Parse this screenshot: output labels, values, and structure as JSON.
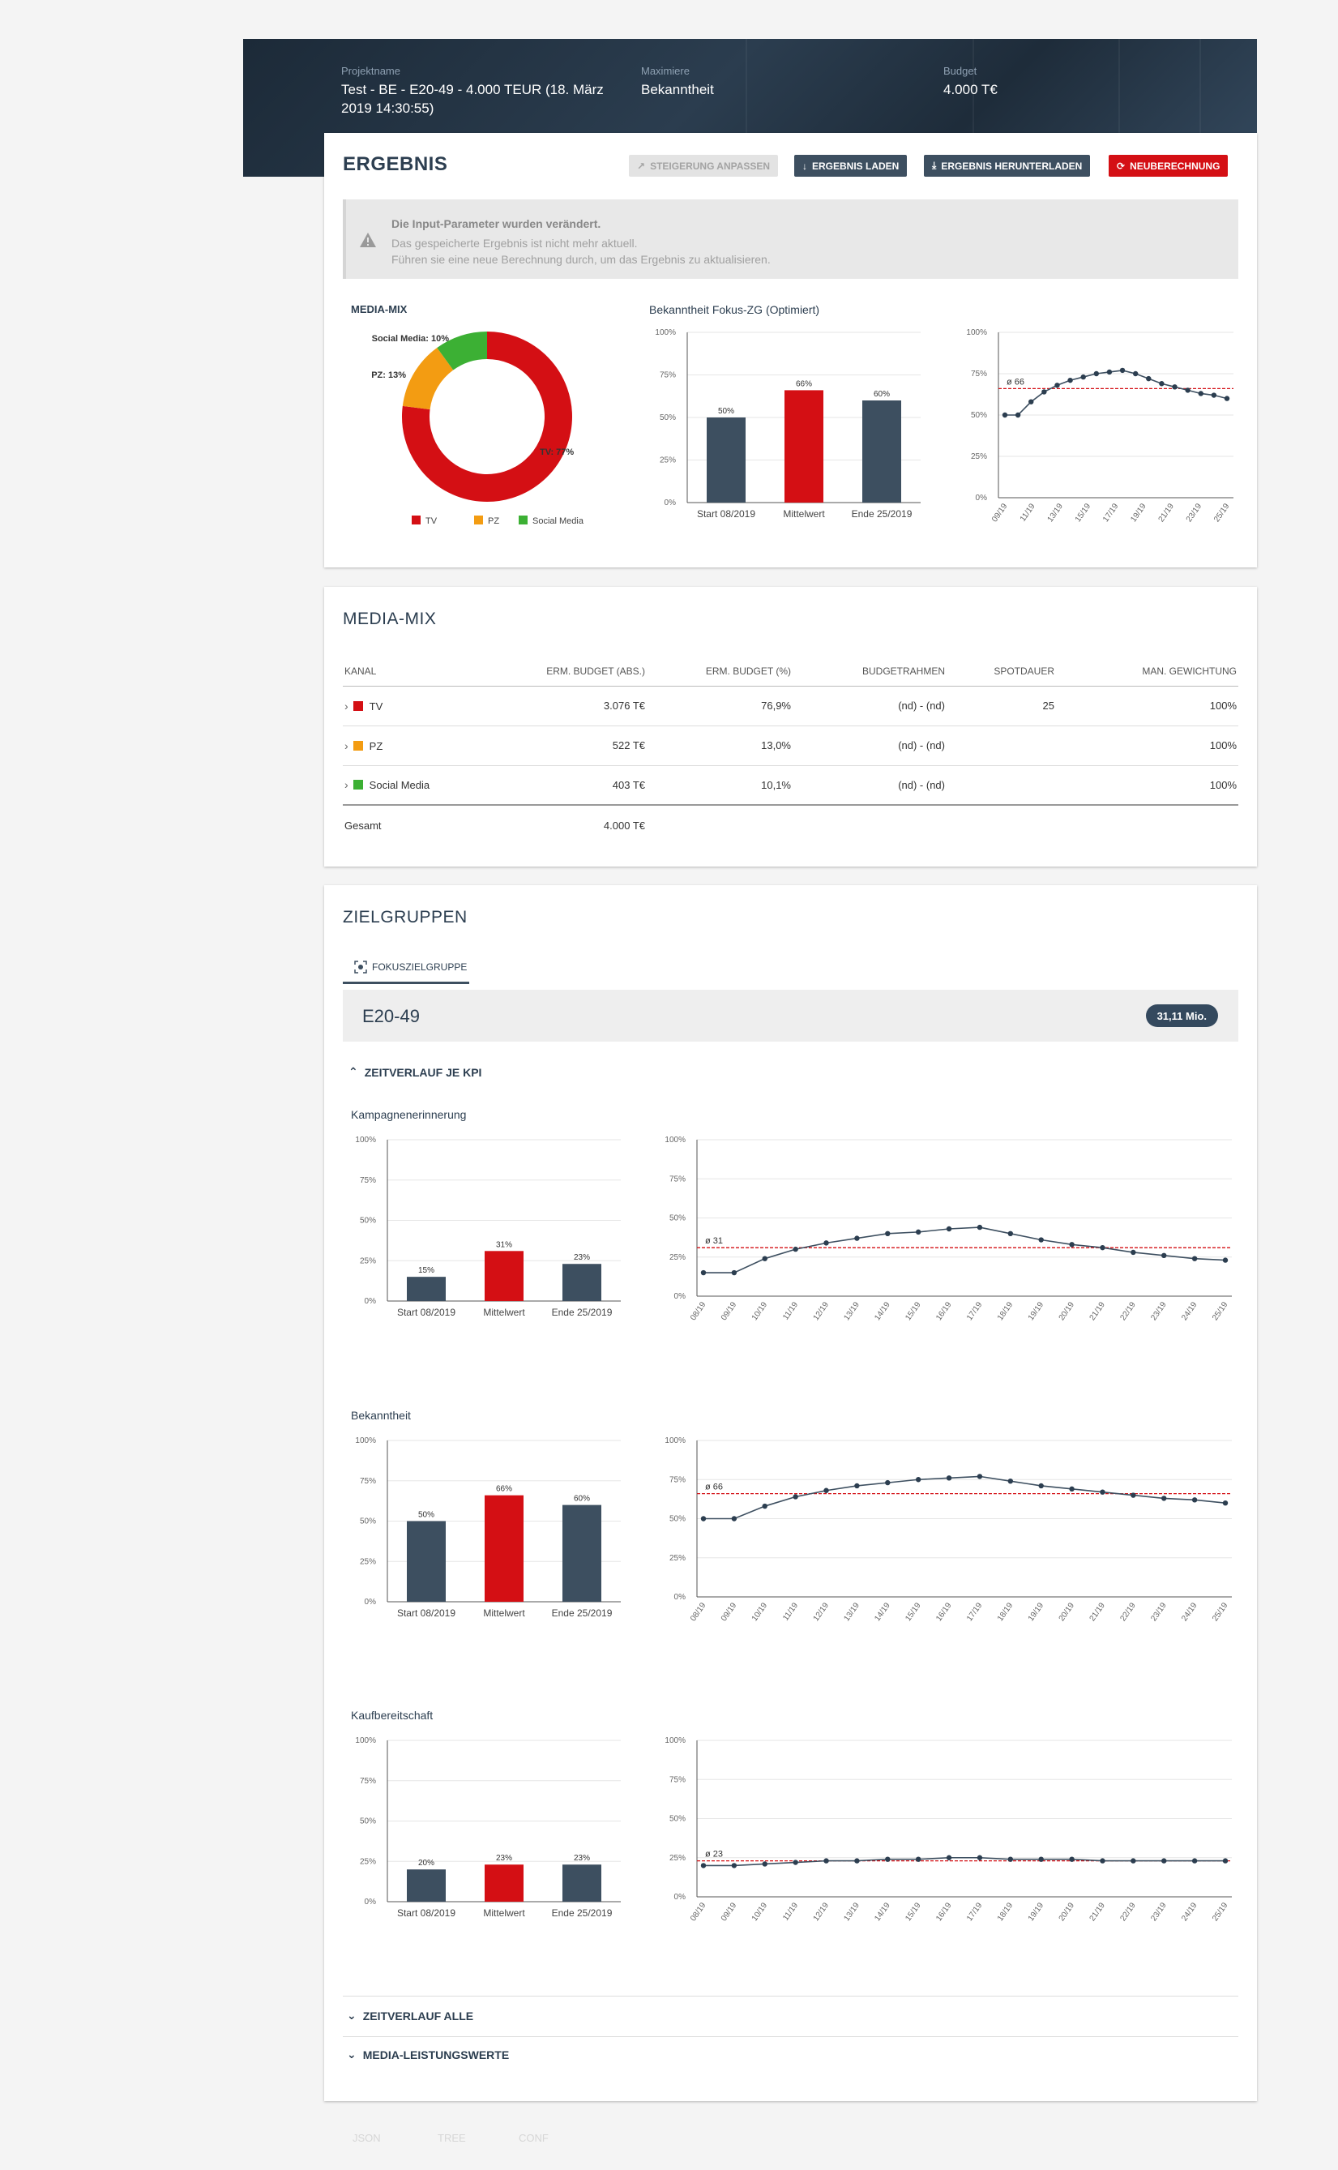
{
  "header": {
    "project_label": "Projektname",
    "project_value": "Test - BE - E20-49 - 4.000 TEUR (18. März 2019 14:30:55)",
    "maximize_label": "Maximiere",
    "maximize_value": "Bekanntheit",
    "budget_label": "Budget",
    "budget_value": "4.000 T€"
  },
  "ergebnis": {
    "title": "ERGEBNIS",
    "buttons": {
      "steigerung": "STEIGERUNG ANPASSEN",
      "laden": "ERGEBNIS LADEN",
      "herunterladen": "ERGEBNIS HERUNTERLADEN",
      "neuberechnung": "NEUBERECHNUNG"
    },
    "warning": {
      "title": "Die Input-Parameter wurden verändert.",
      "line1": "Das gespeicherte Ergebnis ist nicht mehr aktuell.",
      "line2": "Führen sie eine neue Berechnung durch, um das Ergebnis zu aktualisieren."
    },
    "media_mix_label": "MEDIA-MIX",
    "bekanntheit_label": "Bekanntheit Fokus-ZG (Optimiert)",
    "legend": [
      "TV",
      "PZ",
      "Social Media"
    ]
  },
  "colors": {
    "tv": "#d40f14",
    "pz": "#f39c12",
    "social": "#3cb034",
    "bar": "#3d4f60",
    "accent": "#d40f14"
  },
  "chart_data": [
    {
      "type": "pie",
      "title": "MEDIA-MIX",
      "categories": [
        "TV",
        "PZ",
        "Social Media"
      ],
      "values": [
        77,
        13,
        10
      ],
      "labels": [
        "TV: 77%",
        "PZ: 13%",
        "Social Media: 10%"
      ],
      "legend": "bottom"
    },
    {
      "type": "bar",
      "title": "Bekanntheit Fokus-ZG (Optimiert)",
      "categories": [
        "Start 08/2019",
        "Mittelwert",
        "Ende 25/2019"
      ],
      "values": [
        50,
        66,
        60
      ],
      "data_labels": [
        "50%",
        "66%",
        "60%"
      ],
      "yticks": [
        "0%",
        "25%",
        "50%",
        "75%",
        "100%"
      ],
      "ylim": [
        0,
        100
      ]
    },
    {
      "type": "line",
      "x": [
        "09/19",
        "11/19",
        "13/19",
        "15/19",
        "17/19",
        "19/19",
        "21/19",
        "23/19",
        "25/19"
      ],
      "values": [
        50,
        50,
        58,
        64,
        68,
        71,
        73,
        75,
        76,
        77,
        75,
        72,
        69,
        67,
        65,
        63,
        62,
        60
      ],
      "average": 66,
      "average_label": "ø 66",
      "yticks": [
        "0%",
        "25%",
        "50%",
        "75%",
        "100%"
      ],
      "ylim": [
        0,
        100
      ]
    },
    {
      "type": "bar",
      "title": "Kampagnenerinnerung",
      "categories": [
        "Start 08/2019",
        "Mittelwert",
        "Ende 25/2019"
      ],
      "values": [
        15,
        31,
        23
      ],
      "data_labels": [
        "15%",
        "31%",
        "23%"
      ],
      "yticks": [
        "0%",
        "25%",
        "50%",
        "75%",
        "100%"
      ],
      "ylim": [
        0,
        100
      ]
    },
    {
      "type": "line",
      "title": "Kampagnenerinnerung",
      "x": [
        "08/19",
        "09/19",
        "10/19",
        "11/19",
        "12/19",
        "13/19",
        "14/19",
        "15/19",
        "16/19",
        "17/19",
        "18/19",
        "19/19",
        "20/19",
        "21/19",
        "22/19",
        "23/19",
        "24/19",
        "25/19"
      ],
      "values": [
        15,
        15,
        24,
        30,
        34,
        37,
        40,
        41,
        43,
        44,
        40,
        36,
        33,
        31,
        28,
        26,
        24,
        23
      ],
      "average": 31,
      "average_label": "ø 31",
      "yticks": [
        "0%",
        "25%",
        "50%",
        "75%",
        "100%"
      ],
      "ylim": [
        0,
        100
      ]
    },
    {
      "type": "bar",
      "title": "Bekanntheit",
      "categories": [
        "Start 08/2019",
        "Mittelwert",
        "Ende 25/2019"
      ],
      "values": [
        50,
        66,
        60
      ],
      "data_labels": [
        "50%",
        "66%",
        "60%"
      ],
      "yticks": [
        "0%",
        "25%",
        "50%",
        "75%",
        "100%"
      ],
      "ylim": [
        0,
        100
      ]
    },
    {
      "type": "line",
      "title": "Bekanntheit",
      "x": [
        "08/19",
        "09/19",
        "10/19",
        "11/19",
        "12/19",
        "13/19",
        "14/19",
        "15/19",
        "16/19",
        "17/19",
        "18/19",
        "19/19",
        "20/19",
        "21/19",
        "22/19",
        "23/19",
        "24/19",
        "25/19"
      ],
      "values": [
        50,
        50,
        58,
        64,
        68,
        71,
        73,
        75,
        76,
        77,
        74,
        71,
        69,
        67,
        65,
        63,
        62,
        60
      ],
      "average": 66,
      "average_label": "ø 66",
      "yticks": [
        "0%",
        "25%",
        "50%",
        "75%",
        "100%"
      ],
      "ylim": [
        0,
        100
      ]
    },
    {
      "type": "bar",
      "title": "Kaufbereitschaft",
      "categories": [
        "Start 08/2019",
        "Mittelwert",
        "Ende 25/2019"
      ],
      "values": [
        20,
        23,
        23
      ],
      "data_labels": [
        "20%",
        "23%",
        "23%"
      ],
      "yticks": [
        "0%",
        "25%",
        "50%",
        "75%",
        "100%"
      ],
      "ylim": [
        0,
        100
      ]
    },
    {
      "type": "line",
      "title": "Kaufbereitschaft",
      "x": [
        "08/19",
        "09/19",
        "10/19",
        "11/19",
        "12/19",
        "13/19",
        "14/19",
        "15/19",
        "16/19",
        "17/19",
        "18/19",
        "19/19",
        "20/19",
        "21/19",
        "22/19",
        "23/19",
        "24/19",
        "25/19"
      ],
      "values": [
        20,
        20,
        21,
        22,
        23,
        23,
        24,
        24,
        25,
        25,
        24,
        24,
        24,
        23,
        23,
        23,
        23,
        23
      ],
      "average": 23,
      "average_label": "ø 23",
      "yticks": [
        "0%",
        "25%",
        "50%",
        "75%",
        "100%"
      ],
      "ylim": [
        0,
        100
      ]
    }
  ],
  "media_mix_table": {
    "title": "MEDIA-MIX",
    "columns": [
      "KANAL",
      "ERM. BUDGET (ABS.)",
      "ERM. BUDGET (%)",
      "BUDGETRAHMEN",
      "SPOTDAUER",
      "MAN. GEWICHTUNG"
    ],
    "rows": [
      {
        "kanal": "TV",
        "abs": "3.076 T€",
        "pct": "76,9%",
        "rahmen": "(nd) - (nd)",
        "spot": "25",
        "gew": "100%"
      },
      {
        "kanal": "PZ",
        "abs": "522 T€",
        "pct": "13,0%",
        "rahmen": "(nd) - (nd)",
        "spot": "",
        "gew": "100%"
      },
      {
        "kanal": "Social Media",
        "abs": "403 T€",
        "pct": "10,1%",
        "rahmen": "(nd) - (nd)",
        "spot": "",
        "gew": "100%"
      }
    ],
    "total_label": "Gesamt",
    "total_value": "4.000 T€"
  },
  "zielgruppen": {
    "title": "ZIELGRUPPEN",
    "tab": "FOKUSZIELGRUPPE",
    "group_name": "E20-49",
    "group_size": "31,11 Mio.",
    "zeitverlauf_kpi": "ZEITVERLAUF JE KPI",
    "kpi_titles": [
      "Kampagnenerinnerung",
      "Bekanntheit",
      "Kaufbereitschaft"
    ],
    "zeitverlauf_alle": "ZEITVERLAUF ALLE",
    "media_leistungswerte": "MEDIA-LEISTUNGSWERTE"
  },
  "footer": [
    "JSON",
    "TREE",
    "CONF"
  ]
}
